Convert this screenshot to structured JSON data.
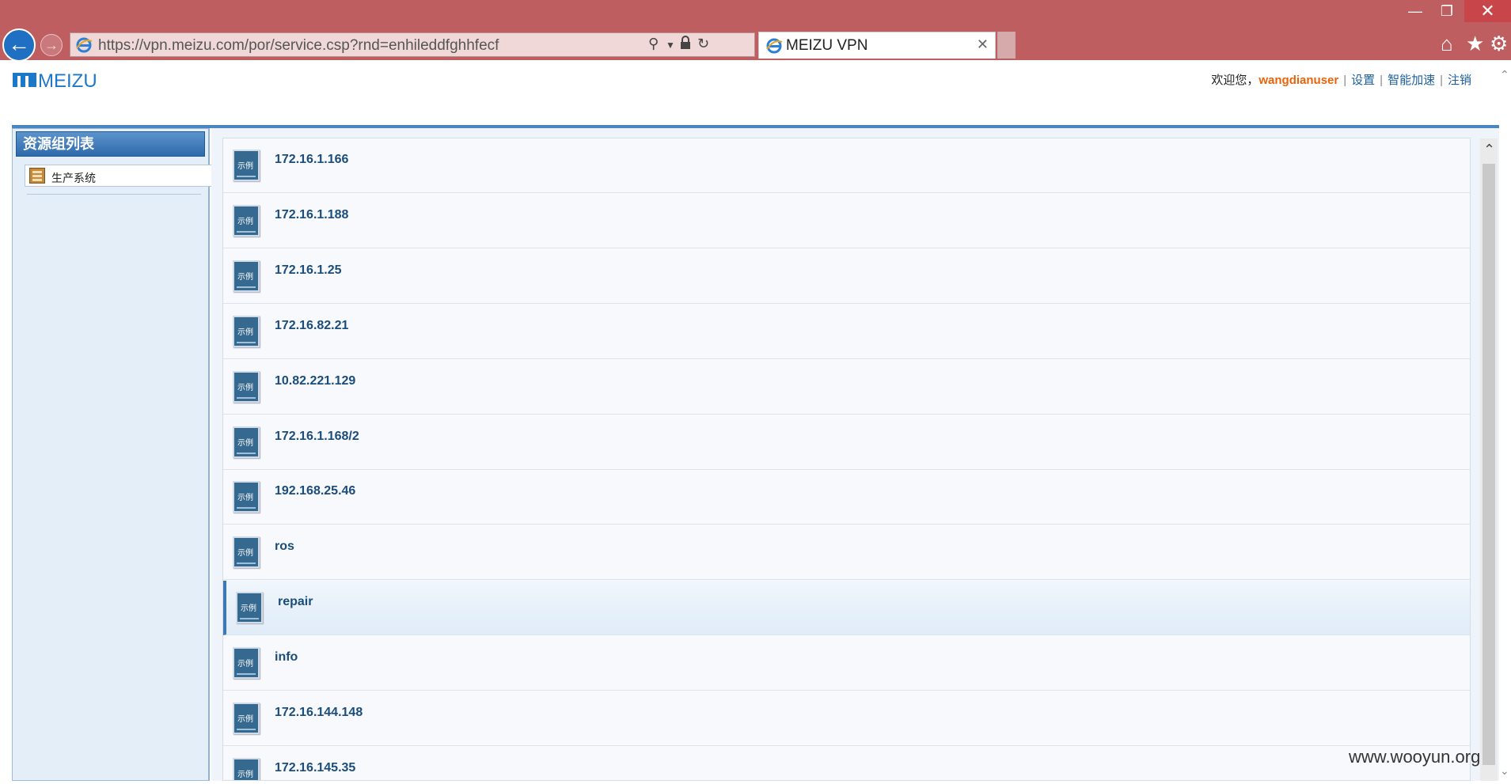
{
  "browser": {
    "address_url": "https://vpn.meizu.com/por/service.csp?rnd=enhileddfghhfecf",
    "tab_title": "MEIZU VPN",
    "window_controls": {
      "minimize": "—",
      "restore": "❐",
      "close": "✕"
    },
    "icons": [
      "back-arrow-icon",
      "forward-arrow-icon",
      "search-icon",
      "lock-icon",
      "refresh-icon",
      "home-icon",
      "favorites-star-icon",
      "settings-gear-icon"
    ]
  },
  "header": {
    "logo_text": "MEIZU",
    "welcome": "欢迎您，",
    "username": "wangdianuser",
    "links": {
      "settings": "设置",
      "accelerate": "智能加速",
      "logout": "注销"
    }
  },
  "sidebar": {
    "title": "资源组列表",
    "groups": [
      {
        "label": "生产系统"
      }
    ]
  },
  "resources": {
    "icon_label": "示例",
    "items": [
      {
        "name": "172.16.1.166"
      },
      {
        "name": "172.16.1.188"
      },
      {
        "name": "172.16.1.25"
      },
      {
        "name": "172.16.82.21"
      },
      {
        "name": "10.82.221.129"
      },
      {
        "name": "172.16.1.168/2"
      },
      {
        "name": "192.168.25.46"
      },
      {
        "name": "ros"
      },
      {
        "name": "repair"
      },
      {
        "name": "info"
      },
      {
        "name": "172.16.144.148"
      },
      {
        "name": "172.16.145.35"
      }
    ],
    "selected_index": 8
  },
  "watermark": "www.wooyun.org",
  "colors": {
    "chrome": "#bf5e60",
    "accent": "#3c77b6",
    "username": "#e8630b",
    "link": "#1d5fa0"
  }
}
